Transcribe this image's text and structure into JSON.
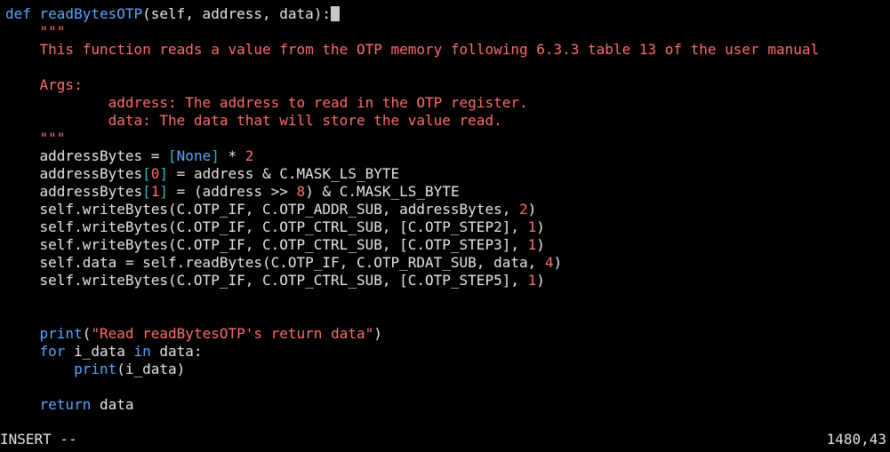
{
  "editor": {
    "lines": [
      {
        "tokens": [
          {
            "t": "def ",
            "c": "kw"
          },
          {
            "t": "readBytesOTP",
            "c": "fn"
          },
          {
            "t": "(self, address, data):",
            "c": "plain"
          }
        ],
        "cursor": true
      },
      {
        "tokens": [
          {
            "t": "    \"\"\"",
            "c": "str"
          }
        ]
      },
      {
        "tokens": [
          {
            "t": "    This function reads a value from the OTP memory following 6.3.3 table 13 of the user manual",
            "c": "str"
          }
        ]
      },
      {
        "tokens": []
      },
      {
        "tokens": [
          {
            "t": "    Args:",
            "c": "str"
          }
        ]
      },
      {
        "tokens": [
          {
            "t": "            address: The address to read in the OTP register.",
            "c": "str"
          }
        ]
      },
      {
        "tokens": [
          {
            "t": "            data: The data that will store the value read.",
            "c": "str"
          }
        ]
      },
      {
        "tokens": [
          {
            "t": "    \"\"\"",
            "c": "str"
          }
        ]
      },
      {
        "tokens": [
          {
            "t": "    addressBytes = ",
            "c": "plain"
          },
          {
            "t": "[",
            "c": "brkt"
          },
          {
            "t": "None",
            "c": "kw"
          },
          {
            "t": "]",
            "c": "brkt"
          },
          {
            "t": " * ",
            "c": "plain"
          },
          {
            "t": "2",
            "c": "num"
          }
        ]
      },
      {
        "tokens": [
          {
            "t": "    addressBytes",
            "c": "plain"
          },
          {
            "t": "[",
            "c": "brkt"
          },
          {
            "t": "0",
            "c": "num"
          },
          {
            "t": "]",
            "c": "brkt"
          },
          {
            "t": " = address & C.MASK_LS_BYTE",
            "c": "plain"
          }
        ]
      },
      {
        "tokens": [
          {
            "t": "    addressBytes",
            "c": "plain"
          },
          {
            "t": "[",
            "c": "brkt"
          },
          {
            "t": "1",
            "c": "num"
          },
          {
            "t": "]",
            "c": "brkt"
          },
          {
            "t": " = (address >> ",
            "c": "plain"
          },
          {
            "t": "8",
            "c": "num"
          },
          {
            "t": ") & C.MASK_LS_BYTE",
            "c": "plain"
          }
        ]
      },
      {
        "tokens": [
          {
            "t": "    self.writeBytes(C.OTP_IF, C.OTP_ADDR_SUB, addressBytes, ",
            "c": "plain"
          },
          {
            "t": "2",
            "c": "num"
          },
          {
            "t": ")",
            "c": "plain"
          }
        ]
      },
      {
        "tokens": [
          {
            "t": "    self.writeBytes(C.OTP_IF, C.OTP_CTRL_SUB, [C.OTP_STEP2], ",
            "c": "plain"
          },
          {
            "t": "1",
            "c": "num"
          },
          {
            "t": ")",
            "c": "plain"
          }
        ]
      },
      {
        "tokens": [
          {
            "t": "    self.writeBytes(C.OTP_IF, C.OTP_CTRL_SUB, [C.OTP_STEP3], ",
            "c": "plain"
          },
          {
            "t": "1",
            "c": "num"
          },
          {
            "t": ")",
            "c": "plain"
          }
        ]
      },
      {
        "tokens": [
          {
            "t": "    self.data = self.readBytes(C.OTP_IF, C.OTP_RDAT_SUB, data, ",
            "c": "plain"
          },
          {
            "t": "4",
            "c": "num"
          },
          {
            "t": ")",
            "c": "plain"
          }
        ]
      },
      {
        "tokens": [
          {
            "t": "    self.writeBytes(C.OTP_IF, C.OTP_CTRL_SUB, [C.OTP_STEP5], ",
            "c": "plain"
          },
          {
            "t": "1",
            "c": "num"
          },
          {
            "t": ")",
            "c": "plain"
          }
        ]
      },
      {
        "tokens": []
      },
      {
        "tokens": []
      },
      {
        "tokens": [
          {
            "t": "    ",
            "c": "plain"
          },
          {
            "t": "print",
            "c": "kw"
          },
          {
            "t": "(",
            "c": "plain"
          },
          {
            "t": "\"Read readBytesOTP's return data\"",
            "c": "str"
          },
          {
            "t": ")",
            "c": "plain"
          }
        ]
      },
      {
        "tokens": [
          {
            "t": "    ",
            "c": "plain"
          },
          {
            "t": "for",
            "c": "kw"
          },
          {
            "t": " i_data ",
            "c": "plain"
          },
          {
            "t": "in",
            "c": "kw"
          },
          {
            "t": " data:",
            "c": "plain"
          }
        ]
      },
      {
        "tokens": [
          {
            "t": "        ",
            "c": "plain"
          },
          {
            "t": "print",
            "c": "kw"
          },
          {
            "t": "(i_data)",
            "c": "plain"
          }
        ]
      },
      {
        "tokens": []
      },
      {
        "tokens": [
          {
            "t": "    ",
            "c": "plain"
          },
          {
            "t": "return",
            "c": "kw"
          },
          {
            "t": " data",
            "c": "plain"
          }
        ]
      }
    ]
  },
  "statusbar": {
    "mode": "INSERT --",
    "position": "1480,43"
  }
}
